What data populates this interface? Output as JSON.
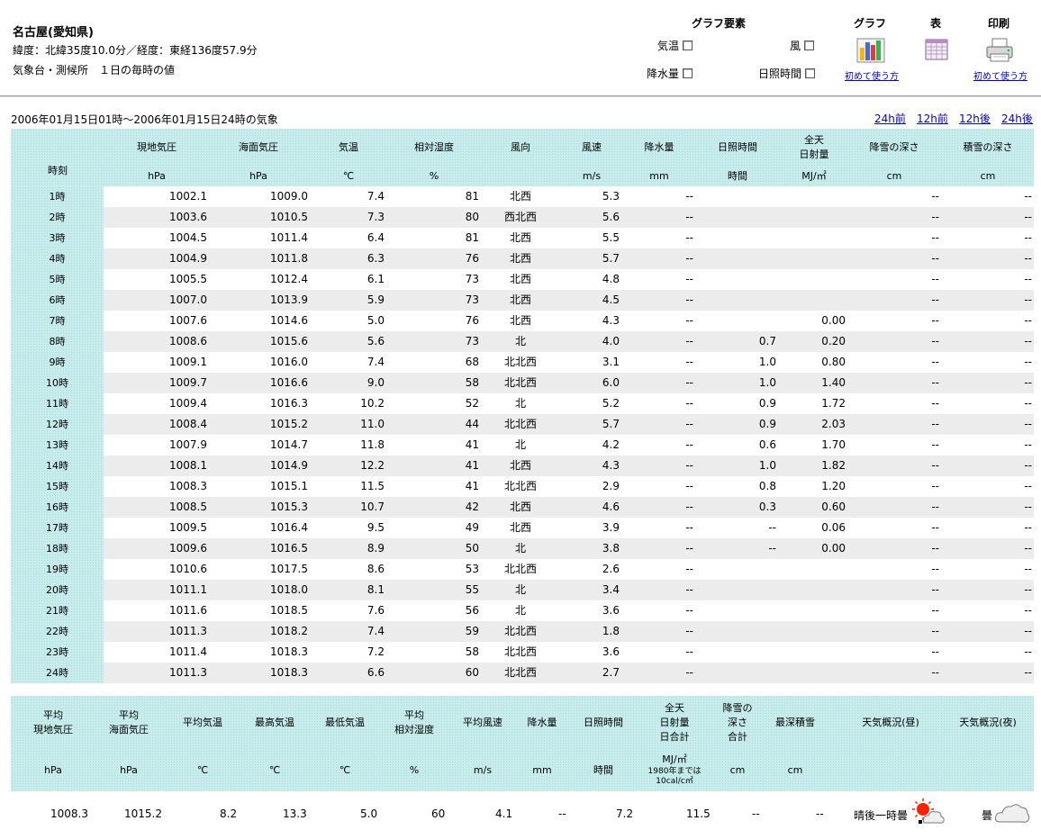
{
  "header": {
    "station": "名古屋(愛知県)",
    "latlon": "緯度：北緯35度10.0分／経度：東経136度57.9分",
    "note": "気象台・測候所　１日の毎時の値",
    "graph_elements_title": "グラフ要素",
    "graph_title": "グラフ",
    "table_title": "表",
    "print_title": "印刷",
    "checkboxes": {
      "temp": "気温",
      "wind": "風",
      "precip": "降水量",
      "sunshine": "日照時間"
    },
    "howto_graph": "初めて使う方",
    "howto_print": "初めて使う方"
  },
  "period": "2006年01月15日01時～2006年01月15日24時の気象",
  "nav": {
    "prev24": "24h前",
    "prev12": "12h前",
    "next12": "12h後",
    "next24": "24h後"
  },
  "table": {
    "headers": {
      "hour": "時刻",
      "press": "現地気圧",
      "sea": "海面気圧",
      "temp": "気温",
      "rh": "相対湿度",
      "wdir": "風向",
      "wspd": "風速",
      "precip": "降水量",
      "sun": "日照時間",
      "rad1": "全天",
      "rad2": "日射量",
      "snowfall": "降雪の深さ",
      "snowdepth": "積雪の深さ"
    },
    "units": {
      "press": "hPa",
      "sea": "hPa",
      "temp": "℃",
      "rh": "%",
      "wspd": "m/s",
      "precip": "mm",
      "sun": "時間",
      "rad": "MJ/㎡",
      "snowfall": "cm",
      "snowdepth": "cm"
    },
    "rows": [
      {
        "h": "1時",
        "p": "1002.1",
        "s": "1009.0",
        "t": "7.4",
        "rh": "81",
        "wd": "北西",
        "ws": "5.3",
        "pr": "--",
        "sun": "",
        "rad": "",
        "sf": "--",
        "sd": "--"
      },
      {
        "h": "2時",
        "p": "1003.6",
        "s": "1010.5",
        "t": "7.3",
        "rh": "80",
        "wd": "西北西",
        "ws": "5.6",
        "pr": "--",
        "sun": "",
        "rad": "",
        "sf": "--",
        "sd": "--"
      },
      {
        "h": "3時",
        "p": "1004.5",
        "s": "1011.4",
        "t": "6.4",
        "rh": "81",
        "wd": "北西",
        "ws": "5.5",
        "pr": "--",
        "sun": "",
        "rad": "",
        "sf": "--",
        "sd": "--"
      },
      {
        "h": "4時",
        "p": "1004.9",
        "s": "1011.8",
        "t": "6.3",
        "rh": "76",
        "wd": "北西",
        "ws": "5.7",
        "pr": "--",
        "sun": "",
        "rad": "",
        "sf": "--",
        "sd": "--"
      },
      {
        "h": "5時",
        "p": "1005.5",
        "s": "1012.4",
        "t": "6.1",
        "rh": "73",
        "wd": "北西",
        "ws": "4.8",
        "pr": "--",
        "sun": "",
        "rad": "",
        "sf": "--",
        "sd": "--"
      },
      {
        "h": "6時",
        "p": "1007.0",
        "s": "1013.9",
        "t": "5.9",
        "rh": "73",
        "wd": "北西",
        "ws": "4.5",
        "pr": "--",
        "sun": "",
        "rad": "",
        "sf": "--",
        "sd": "--"
      },
      {
        "h": "7時",
        "p": "1007.6",
        "s": "1014.6",
        "t": "5.0",
        "rh": "76",
        "wd": "北西",
        "ws": "4.3",
        "pr": "--",
        "sun": "",
        "rad": "0.00",
        "sf": "--",
        "sd": "--"
      },
      {
        "h": "8時",
        "p": "1008.6",
        "s": "1015.6",
        "t": "5.6",
        "rh": "73",
        "wd": "北",
        "ws": "4.0",
        "pr": "--",
        "sun": "0.7",
        "rad": "0.20",
        "sf": "--",
        "sd": "--"
      },
      {
        "h": "9時",
        "p": "1009.1",
        "s": "1016.0",
        "t": "7.4",
        "rh": "68",
        "wd": "北北西",
        "ws": "3.1",
        "pr": "--",
        "sun": "1.0",
        "rad": "0.80",
        "sf": "--",
        "sd": "--"
      },
      {
        "h": "10時",
        "p": "1009.7",
        "s": "1016.6",
        "t": "9.0",
        "rh": "58",
        "wd": "北北西",
        "ws": "6.0",
        "pr": "--",
        "sun": "1.0",
        "rad": "1.40",
        "sf": "--",
        "sd": "--"
      },
      {
        "h": "11時",
        "p": "1009.4",
        "s": "1016.3",
        "t": "10.2",
        "rh": "52",
        "wd": "北",
        "ws": "5.2",
        "pr": "--",
        "sun": "0.9",
        "rad": "1.72",
        "sf": "--",
        "sd": "--"
      },
      {
        "h": "12時",
        "p": "1008.4",
        "s": "1015.2",
        "t": "11.0",
        "rh": "44",
        "wd": "北北西",
        "ws": "5.7",
        "pr": "--",
        "sun": "0.9",
        "rad": "2.03",
        "sf": "--",
        "sd": "--"
      },
      {
        "h": "13時",
        "p": "1007.9",
        "s": "1014.7",
        "t": "11.8",
        "rh": "41",
        "wd": "北",
        "ws": "4.2",
        "pr": "--",
        "sun": "0.6",
        "rad": "1.70",
        "sf": "--",
        "sd": "--"
      },
      {
        "h": "14時",
        "p": "1008.1",
        "s": "1014.9",
        "t": "12.2",
        "rh": "41",
        "wd": "北西",
        "ws": "4.3",
        "pr": "--",
        "sun": "1.0",
        "rad": "1.82",
        "sf": "--",
        "sd": "--"
      },
      {
        "h": "15時",
        "p": "1008.3",
        "s": "1015.1",
        "t": "11.5",
        "rh": "41",
        "wd": "北北西",
        "ws": "2.9",
        "pr": "--",
        "sun": "0.8",
        "rad": "1.20",
        "sf": "--",
        "sd": "--"
      },
      {
        "h": "16時",
        "p": "1008.5",
        "s": "1015.3",
        "t": "10.7",
        "rh": "42",
        "wd": "北西",
        "ws": "4.6",
        "pr": "--",
        "sun": "0.3",
        "rad": "0.60",
        "sf": "--",
        "sd": "--"
      },
      {
        "h": "17時",
        "p": "1009.5",
        "s": "1016.4",
        "t": "9.5",
        "rh": "49",
        "wd": "北西",
        "ws": "3.9",
        "pr": "--",
        "sun": "--",
        "rad": "0.06",
        "sf": "--",
        "sd": "--"
      },
      {
        "h": "18時",
        "p": "1009.6",
        "s": "1016.5",
        "t": "8.9",
        "rh": "50",
        "wd": "北",
        "ws": "3.8",
        "pr": "--",
        "sun": "--",
        "rad": "0.00",
        "sf": "--",
        "sd": "--"
      },
      {
        "h": "19時",
        "p": "1010.6",
        "s": "1017.5",
        "t": "8.6",
        "rh": "53",
        "wd": "北北西",
        "ws": "2.6",
        "pr": "--",
        "sun": "",
        "rad": "",
        "sf": "--",
        "sd": "--"
      },
      {
        "h": "20時",
        "p": "1011.1",
        "s": "1018.0",
        "t": "8.1",
        "rh": "55",
        "wd": "北",
        "ws": "3.4",
        "pr": "--",
        "sun": "",
        "rad": "",
        "sf": "--",
        "sd": "--"
      },
      {
        "h": "21時",
        "p": "1011.6",
        "s": "1018.5",
        "t": "7.6",
        "rh": "56",
        "wd": "北",
        "ws": "3.6",
        "pr": "--",
        "sun": "",
        "rad": "",
        "sf": "--",
        "sd": "--"
      },
      {
        "h": "22時",
        "p": "1011.3",
        "s": "1018.2",
        "t": "7.4",
        "rh": "59",
        "wd": "北北西",
        "ws": "1.8",
        "pr": "--",
        "sun": "",
        "rad": "",
        "sf": "--",
        "sd": "--"
      },
      {
        "h": "23時",
        "p": "1011.4",
        "s": "1018.3",
        "t": "7.2",
        "rh": "58",
        "wd": "北北西",
        "ws": "3.6",
        "pr": "--",
        "sun": "",
        "rad": "",
        "sf": "--",
        "sd": "--"
      },
      {
        "h": "24時",
        "p": "1011.3",
        "s": "1018.3",
        "t": "6.6",
        "rh": "60",
        "wd": "北北西",
        "ws": "2.7",
        "pr": "--",
        "sun": "",
        "rad": "",
        "sf": "--",
        "sd": "--"
      }
    ]
  },
  "summary": {
    "headers": {
      "avg_press_1": "平均",
      "avg_press_2": "現地気圧",
      "avg_sea_1": "平均",
      "avg_sea_2": "海面気圧",
      "avg_temp": "平均気温",
      "max_temp": "最高気温",
      "min_temp": "最低気温",
      "avg_rh_1": "平均",
      "avg_rh_2": "相対湿度",
      "avg_wind": "平均風速",
      "precip": "降水量",
      "sun": "日照時間",
      "rad_1": "全天",
      "rad_2": "日射量",
      "rad_3": "日合計",
      "snowfall_1": "降雪の",
      "snowfall_2": "深さ",
      "snowfall_3": "合計",
      "max_snow": "最深積雪",
      "weather_day": "天気概況(昼)",
      "weather_night": "天気概況(夜)"
    },
    "units": {
      "press": "hPa",
      "sea": "hPa",
      "avg_temp": "℃",
      "max_temp": "℃",
      "min_temp": "℃",
      "rh": "%",
      "wind": "m/s",
      "precip": "mm",
      "sun": "時間",
      "rad": "MJ/㎡",
      "rad_note_1": "1980年までは",
      "rad_note_2": "10cal/c㎡",
      "snowfall": "cm",
      "max_snow": "cm"
    },
    "values": {
      "press": "1008.3",
      "sea": "1015.2",
      "avg_temp": "8.2",
      "max_temp": "13.3",
      "min_temp": "5.0",
      "rh": "60",
      "wind": "4.1",
      "precip": "--",
      "sun": "7.2",
      "rad": "11.5",
      "snowfall": "--",
      "max_snow": "--",
      "weather_day": "晴後一時曇",
      "weather_night": "曇"
    }
  },
  "colors": {
    "header_bg": "#c8ecec",
    "alt_row": "#ececec",
    "link": "#0000cc",
    "sun": "#ff2200"
  },
  "icons": {
    "graph": "bar-chart-icon",
    "table": "table-icon",
    "print": "printer-icon",
    "weather_day": "sun-cloud-icon",
    "weather_night": "cloud-icon"
  }
}
